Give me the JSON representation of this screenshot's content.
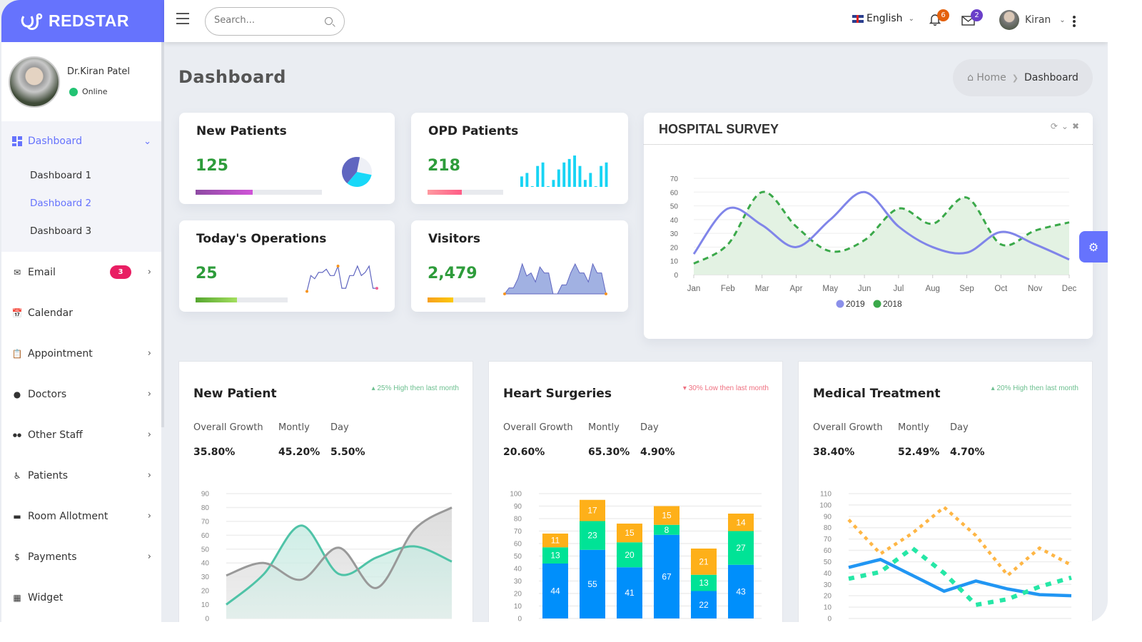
{
  "brand": {
    "name": "REDSTAR",
    "color": "#6673fd"
  },
  "header": {
    "search_placeholder": "Search...",
    "language": "English",
    "notifications_count": "6",
    "messages_count": "2",
    "user_name": "Kiran",
    "icons": {
      "menu": "hamburger-icon",
      "search": "search-icon",
      "bell": "bell-icon",
      "mail": "envelope-icon",
      "more": "kebab-icon"
    }
  },
  "profile": {
    "name": "Dr.Kiran Patel",
    "status": "Online"
  },
  "sidebar": {
    "dashboard": {
      "label": "Dashboard",
      "icon": "dashboard-icon",
      "sub": [
        "Dashboard 1",
        "Dashboard 2",
        "Dashboard 3"
      ],
      "active_sub": "Dashboard 2"
    },
    "items": [
      {
        "label": "Email",
        "icon": "envelope-icon",
        "badge": "3",
        "arrow": true
      },
      {
        "label": "Calendar",
        "icon": "calendar-icon",
        "arrow": false
      },
      {
        "label": "Appointment",
        "icon": "clipboard-icon",
        "arrow": true
      },
      {
        "label": "Doctors",
        "icon": "person-icon",
        "arrow": true
      },
      {
        "label": "Other Staff",
        "icon": "people-icon",
        "arrow": true
      },
      {
        "label": "Patients",
        "icon": "wheelchair-icon",
        "arrow": true
      },
      {
        "label": "Room Allotment",
        "icon": "bed-icon",
        "arrow": true
      },
      {
        "label": "Payments",
        "icon": "dollar-icon",
        "arrow": true
      },
      {
        "label": "Widget",
        "icon": "widget-icon",
        "arrow": false
      }
    ]
  },
  "page": {
    "title": "Dashboard",
    "breadcrumb": {
      "home": "Home",
      "current": "Dashboard"
    }
  },
  "stats": [
    {
      "title": "New Patients",
      "value": "125",
      "progress": 0.45,
      "bar": [
        "#8e4ba3",
        "#d054d8"
      ]
    },
    {
      "title": "OPD Patients",
      "value": "218",
      "progress": 0.45,
      "bar": [
        "#fe9aa0",
        "#ff5c86"
      ]
    },
    {
      "title": "Today's Operations",
      "value": "25",
      "progress": 0.45,
      "bar": [
        "#56a630",
        "#a3de5e"
      ]
    },
    {
      "title": "Visitors",
      "value": "2,479",
      "progress": 0.45,
      "bar": [
        "#f7a020",
        "#fcc90a"
      ]
    }
  ],
  "sparklines": {
    "new_patients_pie": [
      42,
      33,
      25
    ],
    "opd_bars": [
      3,
      4,
      0,
      6,
      7,
      0,
      2,
      5,
      7,
      8,
      9,
      6,
      2,
      4,
      0,
      6,
      7
    ],
    "operations_line": [
      1,
      6,
      5,
      7,
      7,
      8,
      6,
      6,
      9,
      2,
      2,
      6,
      6,
      9,
      6,
      7,
      9,
      2,
      2
    ],
    "visitors_area": [
      0,
      2,
      2,
      5,
      10,
      6,
      7,
      4,
      9,
      7,
      7,
      0,
      0,
      3,
      3,
      7,
      10,
      7,
      7,
      4,
      10,
      7,
      7,
      0
    ]
  },
  "survey": {
    "title": "HOSPITAL SURVEY",
    "tools": [
      "refresh-icon",
      "collapse-icon",
      "close-icon"
    ]
  },
  "chart_data": [
    {
      "type": "area",
      "title": "HOSPITAL SURVEY",
      "categories": [
        "Jan",
        "Feb",
        "Mar",
        "Apr",
        "May",
        "Jun",
        "Jul",
        "Aug",
        "Sep",
        "Oct",
        "Nov",
        "Dec"
      ],
      "series": [
        {
          "name": "2019",
          "values": [
            15,
            48,
            36,
            20,
            40,
            60,
            35,
            20,
            16,
            31,
            22,
            11
          ],
          "color": "#8085e9",
          "style": "solid"
        },
        {
          "name": "2018",
          "values": [
            8,
            22,
            60,
            35,
            17,
            25,
            48,
            37,
            56,
            22,
            32,
            38
          ],
          "color": "#3ba94a",
          "style": "dashed"
        }
      ],
      "yticks": [
        0,
        10,
        20,
        30,
        40,
        50,
        60,
        70
      ],
      "ylim": [
        0,
        70
      ],
      "legend": "bottom"
    },
    {
      "type": "area",
      "title": "New Patient",
      "series": [
        {
          "name": "series1",
          "values": [
            10,
            32,
            67,
            32,
            44,
            52,
            41
          ],
          "color": "#4fc3a7"
        },
        {
          "name": "series2",
          "values": [
            31,
            40,
            28,
            51,
            22,
            64,
            80
          ],
          "color": "#999999"
        }
      ],
      "yticks": [
        0,
        10,
        20,
        30,
        40,
        50,
        60,
        70,
        80,
        90
      ],
      "ylim": [
        0,
        90
      ]
    },
    {
      "type": "bar",
      "title": "Heart Surgeries",
      "stacked": true,
      "series": [
        {
          "name": "series1",
          "values": [
            44,
            55,
            41,
            67,
            22,
            43
          ],
          "color": "#008ffb"
        },
        {
          "name": "series2",
          "values": [
            13,
            23,
            20,
            8,
            13,
            27
          ],
          "color": "#00e396"
        },
        {
          "name": "series3",
          "values": [
            11,
            17,
            15,
            15,
            21,
            14
          ],
          "color": "#feb019"
        }
      ],
      "yticks": [
        0,
        10,
        20,
        30,
        40,
        50,
        60,
        70,
        80,
        90,
        100
      ],
      "ylim": [
        0,
        100
      ]
    },
    {
      "type": "line",
      "title": "Medical Treatment",
      "series": [
        {
          "name": "series1",
          "values": [
            45,
            52,
            38,
            24,
            33,
            26,
            21,
            20
          ],
          "color": "#2196f3",
          "style": "solid"
        },
        {
          "name": "series2",
          "values": [
            35,
            41,
            62,
            40,
            12,
            17,
            28,
            36
          ],
          "color": "#26e7a6",
          "style": "dotted"
        },
        {
          "name": "series3",
          "values": [
            87,
            57,
            75,
            98,
            73,
            38,
            62,
            47
          ],
          "color": "#feb645",
          "style": "dotted"
        }
      ],
      "yticks": [
        0,
        10,
        20,
        30,
        40,
        50,
        60,
        70,
        80,
        90,
        100,
        110
      ],
      "ylim": [
        0,
        110
      ]
    }
  ],
  "bottom_cards": [
    {
      "title": "New Patient",
      "trend": "25% High then last month",
      "trend_dir": "up",
      "trend_color": "#6cbf8f",
      "labels": [
        "Overall Growth",
        "Montly",
        "Day"
      ],
      "values": [
        "35.80%",
        "45.20%",
        "5.50%"
      ]
    },
    {
      "title": "Heart Surgeries",
      "trend": "30% Low then last month",
      "trend_dir": "down",
      "trend_color": "#ef6f7f",
      "labels": [
        "Overall Growth",
        "Montly",
        "Day"
      ],
      "values": [
        "20.60%",
        "65.30%",
        "4.90%"
      ]
    },
    {
      "title": "Medical Treatment",
      "trend": "20% High then last month",
      "trend_dir": "up",
      "trend_color": "#6cbf8f",
      "labels": [
        "Overall Growth",
        "Montly",
        "Day"
      ],
      "values": [
        "38.40%",
        "52.49%",
        "4.70%"
      ]
    }
  ]
}
